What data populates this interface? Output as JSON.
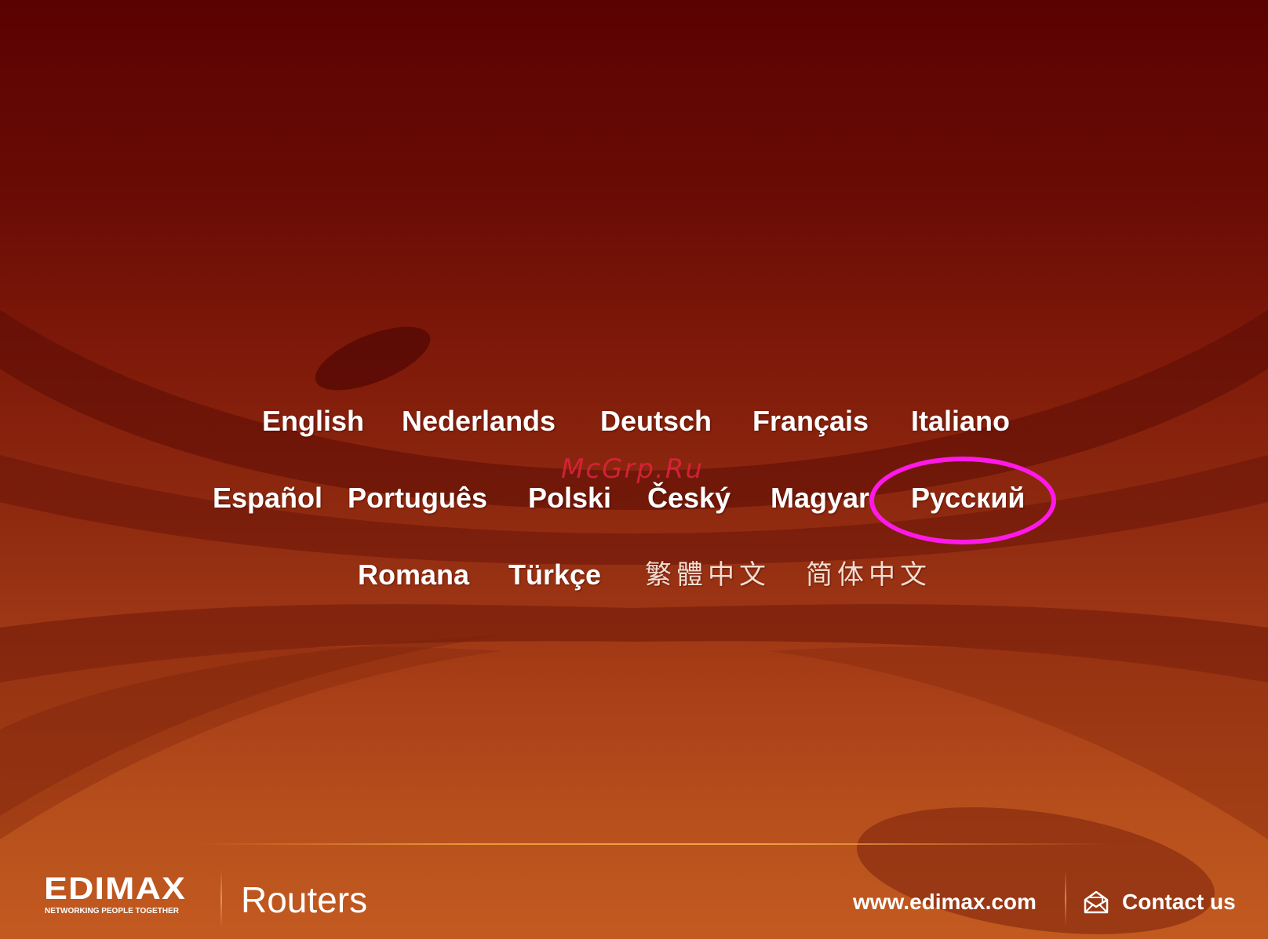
{
  "languages": {
    "row1": [
      "English",
      "Nederlands",
      "Deutsch",
      "Français",
      "Italiano"
    ],
    "row2": [
      "Español",
      "Português",
      "Polski",
      "Český",
      "Magyar",
      "Русский"
    ],
    "row3": [
      "Romana",
      "Türkçe",
      "繁體中文",
      "简体中文"
    ]
  },
  "selected_language": "Русский",
  "watermark": "McGrp.Ru",
  "brand": {
    "logo_text": "EDIMAX",
    "tagline": "NETWORKING PEOPLE TOGETHER"
  },
  "category": "Routers",
  "footer": {
    "website": "www.edimax.com",
    "contact_label": "Contact us",
    "contact_icon": "envelope-icon"
  },
  "colors": {
    "background_top": "#5a0202",
    "background_bottom": "#c25a20",
    "highlight_ring": "#ff19e8",
    "watermark": "#e0233d",
    "text": "#ffffff"
  }
}
